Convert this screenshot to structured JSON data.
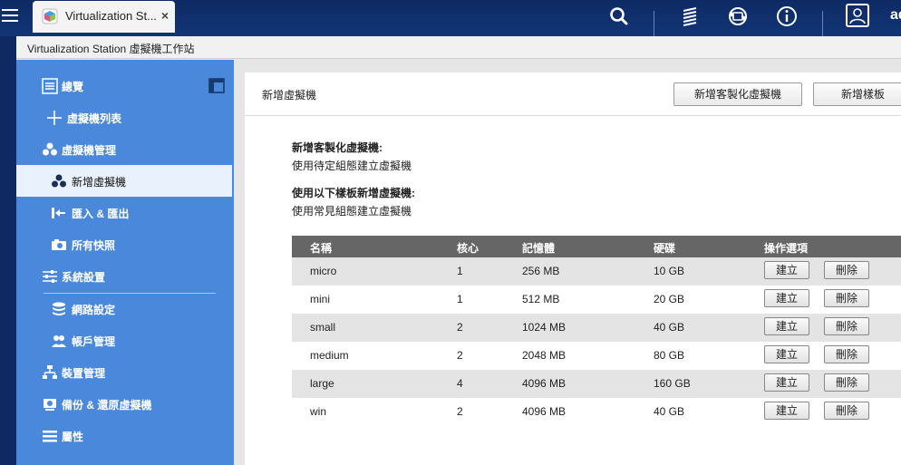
{
  "topbar": {
    "tab_title": "Virtualization St...",
    "close_symbol": "×",
    "username": "ad"
  },
  "window": {
    "title": "Virtualization Station 虛擬機工作站"
  },
  "sidebar": {
    "items": [
      {
        "label": "總覽"
      },
      {
        "label": "虛擬機列表"
      },
      {
        "label": "虛擬機管理"
      },
      {
        "label": "新增虛擬機"
      },
      {
        "label": "匯入 & 匯出"
      },
      {
        "label": "所有快照"
      },
      {
        "label": "系統設置"
      },
      {
        "label": "網路設定"
      },
      {
        "label": "帳戶管理"
      },
      {
        "label": "裝置管理"
      },
      {
        "label": "備份 & 還原虛擬機"
      },
      {
        "label": "屬性"
      }
    ]
  },
  "main": {
    "title": "新增虛擬機",
    "btn_custom": "新增客製化虛擬機",
    "btn_template": "新增樣板",
    "custom_title": "新增客製化虛擬機:",
    "custom_desc": "使用待定組態建立虛擬機",
    "template_title": "使用以下樣板新增虛擬機:",
    "template_desc": "使用常見組態建立虛擬機"
  },
  "table": {
    "headers": [
      "名稱",
      "核心",
      "記憶體",
      "硬碟",
      "操作選項"
    ],
    "rows": [
      {
        "name": "micro",
        "cores": "1",
        "memory": "256 MB",
        "disk": "10 GB",
        "create": "建立",
        "delete": "刪除"
      },
      {
        "name": "mini",
        "cores": "1",
        "memory": "512 MB",
        "disk": "20 GB",
        "create": "建立",
        "delete": "刪除"
      },
      {
        "name": "small",
        "cores": "2",
        "memory": "1024 MB",
        "disk": "40 GB",
        "create": "建立",
        "delete": "刪除"
      },
      {
        "name": "medium",
        "cores": "2",
        "memory": "2048 MB",
        "disk": "80 GB",
        "create": "建立",
        "delete": "刪除"
      },
      {
        "name": "large",
        "cores": "4",
        "memory": "4096 MB",
        "disk": "160 GB",
        "create": "建立",
        "delete": "刪除"
      },
      {
        "name": "win",
        "cores": "2",
        "memory": "4096 MB",
        "disk": "40 GB",
        "create": "建立",
        "delete": "刪除"
      }
    ]
  }
}
